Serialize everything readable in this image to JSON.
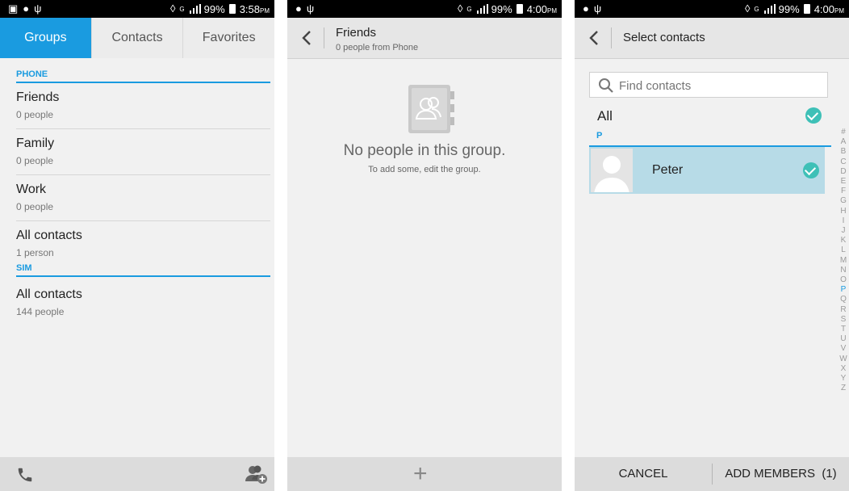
{
  "screen1": {
    "status": {
      "time": "3:58",
      "ampm": "PM",
      "battery": "99%",
      "net": "G"
    },
    "tabs": [
      "Groups",
      "Contacts",
      "Favorites"
    ],
    "sections": [
      {
        "label": "PHONE",
        "groups": [
          {
            "name": "Friends",
            "count": "0 people"
          },
          {
            "name": "Family",
            "count": "0 people"
          },
          {
            "name": "Work",
            "count": "0 people"
          },
          {
            "name": "All contacts",
            "count": "1 person"
          }
        ]
      },
      {
        "label": "SIM",
        "groups": [
          {
            "name": "All contacts",
            "count": "144 people"
          }
        ]
      }
    ],
    "icons": {
      "left": "phone-icon",
      "right": "add-group-icon"
    }
  },
  "screen2": {
    "status": {
      "time": "4:00",
      "ampm": "PM",
      "battery": "99%",
      "net": "G"
    },
    "title": "Friends",
    "subtitle": "0 people from Phone",
    "empty_title": "No people in this group.",
    "empty_sub": "To add some, edit the group.",
    "icons": {
      "empty": "contacts-book-icon",
      "add": "plus-icon"
    }
  },
  "screen3": {
    "status": {
      "time": "4:00",
      "ampm": "PM",
      "battery": "99%",
      "net": "G"
    },
    "title": "Select contacts",
    "search_placeholder": "Find contacts",
    "all_label": "All",
    "section": "P",
    "contact": {
      "name": "Peter",
      "selected": true
    },
    "alphabet": [
      "#",
      "A",
      "B",
      "C",
      "D",
      "E",
      "F",
      "G",
      "H",
      "I",
      "J",
      "K",
      "L",
      "M",
      "N",
      "O",
      "P",
      "Q",
      "R",
      "S",
      "T",
      "U",
      "V",
      "W",
      "X",
      "Y",
      "Z"
    ],
    "alphabet_active": "P",
    "cancel": "CANCEL",
    "add_members": "ADD MEMBERS",
    "add_count": "(1)"
  },
  "colors": {
    "accent": "#1a9be0",
    "check": "#3ec0b7",
    "selected_row": "#b7dbe7"
  }
}
